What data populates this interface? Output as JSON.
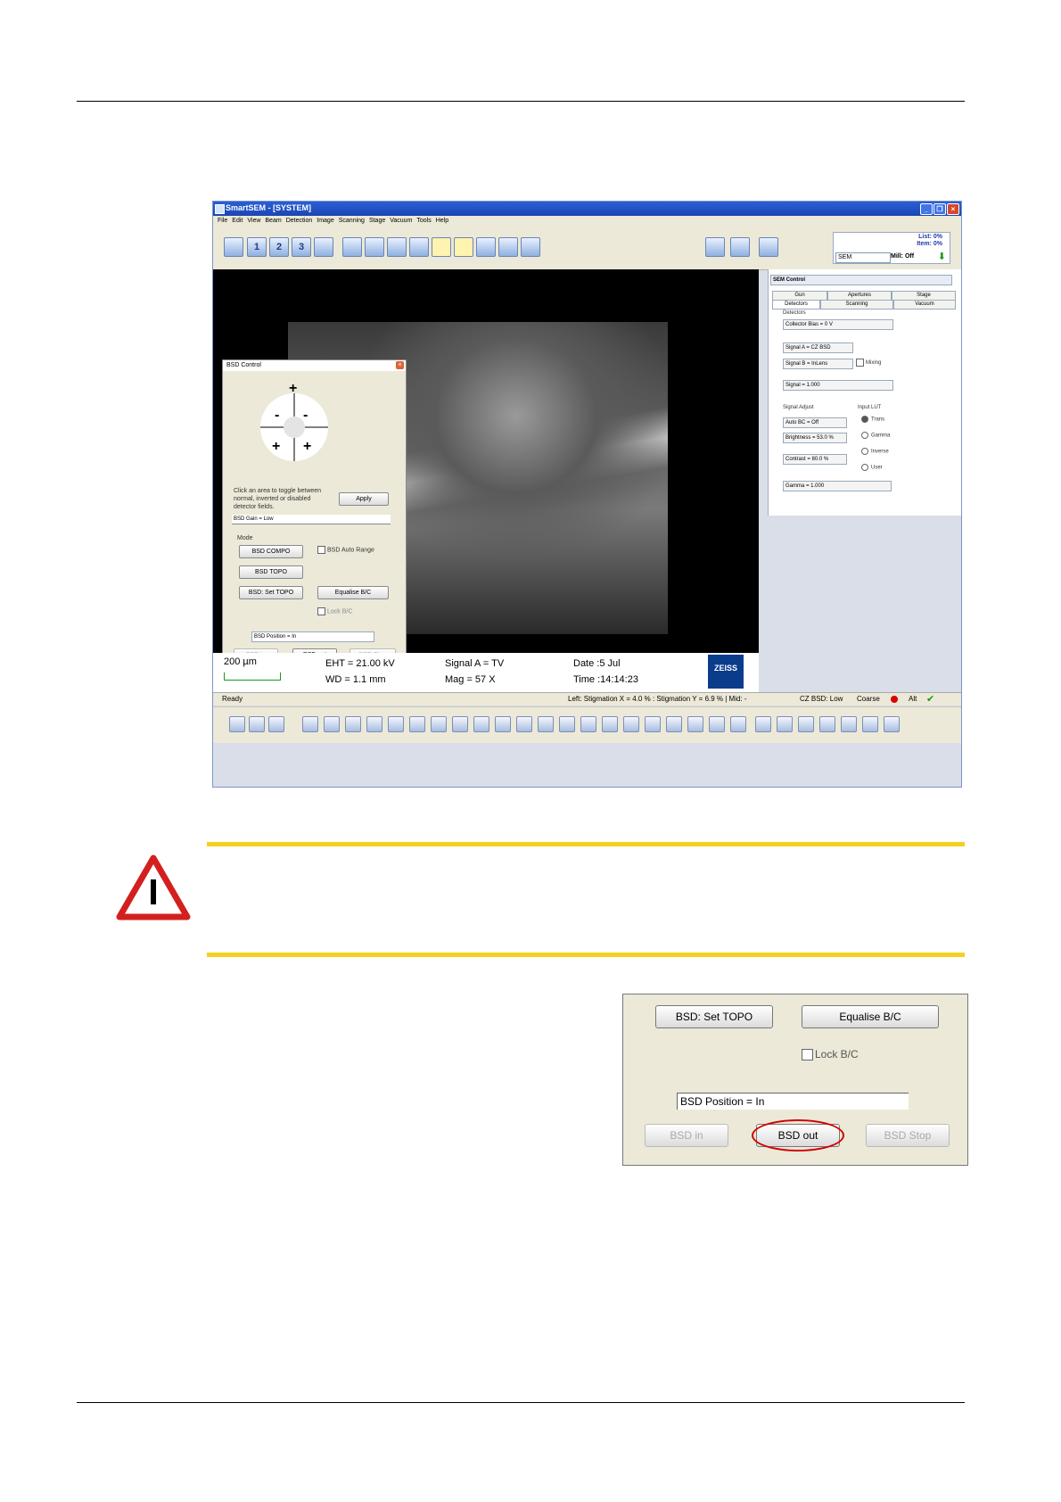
{
  "app": {
    "title": "SmartSEM - [SYSTEM]",
    "menu": [
      "File",
      "Edit",
      "View",
      "Beam",
      "Detection",
      "Image",
      "Scanning",
      "Stage",
      "Vacuum",
      "Tools",
      "Help"
    ],
    "toolbar_icons": [
      "1",
      "2",
      "3"
    ],
    "ctx": {
      "list": "List: 0%",
      "item": "Item: 0%",
      "mode": "SEM",
      "mill": "Mill: Off"
    }
  },
  "bsd_control": {
    "title": "BSD Control",
    "hint": "Click an area to toggle between normal, inverted or disabled detector fields.",
    "apply": "Apply",
    "gain": "BSD Gain = Low",
    "mode_label": "Mode",
    "compo": "BSD COMPO",
    "topo": "BSD TOPO",
    "set_topo": "BSD: Set TOPO",
    "auto_range": "BSD Auto Range",
    "equalise": "Equalise B/C",
    "lock": "Lock B/C",
    "position": "BSD Position = In",
    "bsd_in": "BSD in",
    "bsd_out": "BSD out",
    "bsd_stop": "BSD Stop"
  },
  "sem_control": {
    "title": "SEM Control",
    "tabs_top": [
      "Gun",
      "Apertures",
      "Stage"
    ],
    "tabs_bottom": [
      "Detectors",
      "Scanning",
      "Vacuum"
    ],
    "detectors_label": "Detectors",
    "collector": "Collector Bias =   0 V",
    "signal_a": "Signal A = CZ BSD",
    "signal_b": "Signal B = InLens",
    "mixing": "Mixing",
    "signal": "Signal = 1.000",
    "signal_adjust": "Signal Adjust",
    "input_lut": "Input LUT",
    "auto_bc": "Auto BC = Off",
    "brightness": "Brightness = 53.0 %",
    "contrast": "Contrast = 80.0 %",
    "gamma": "Gamma = 1.000",
    "lut_options": [
      "Trans",
      "Gamma",
      "Inverse",
      "User"
    ]
  },
  "databar": {
    "scale": "200 µm",
    "eht": "EHT = 21.00 kV",
    "wd": "WD =  1.1 mm",
    "signal": "Signal A = TV",
    "mag": "Mag =     57 X",
    "date": "Date :5 Jul",
    "time": "Time :14:14:23",
    "logo": "ZEISS"
  },
  "status": {
    "ready": "Ready",
    "stig": "Left: Stigmation X =   4.0 % : Stigmation Y =   6.9 % | Mid: -",
    "bsd": "CZ BSD: Low",
    "coarse": "Coarse",
    "alt": "Alt"
  },
  "zoom": {
    "set_topo": "BSD: Set TOPO",
    "equalise": "Equalise B/C",
    "lock": "Lock B/C",
    "position": "BSD Position = In",
    "bsd_in": "BSD in",
    "bsd_out": "BSD out",
    "bsd_stop": "BSD Stop"
  },
  "colors": {
    "caution_yellow": "#f5d020",
    "warning_red": "#d3201f",
    "highlight_circle": "#d00000"
  }
}
